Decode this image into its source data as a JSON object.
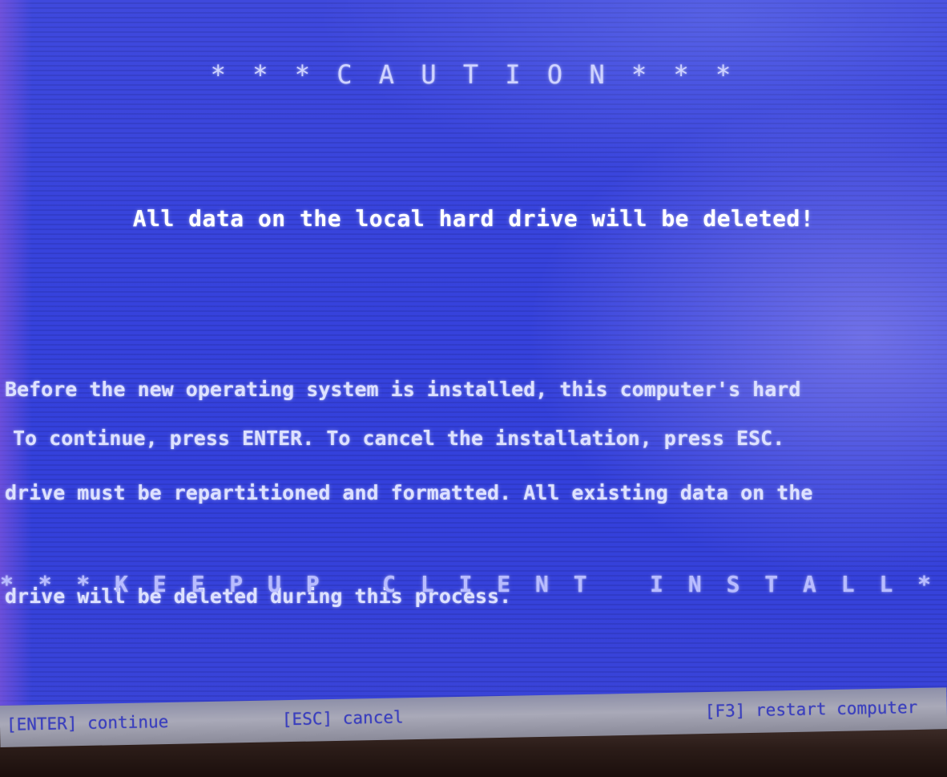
{
  "screen": {
    "background_color": "#3743dc",
    "caution_title": "* * * C A U T I O N * * *",
    "warning": "All data on the local hard drive will be deleted!",
    "paragraph_lines": [
      "Before the new operating system is installed, this computer's hard",
      "drive must be repartitioned and formatted. All existing data on the",
      "drive will be deleted during this process."
    ],
    "instruction": "To continue, press ENTER. To cancel the installation, press ESC.",
    "footer_title": "* * * K E E P U P   C L I E N T   I N S T A L L * * *"
  },
  "statusbar": {
    "background_color": "#a9a9b8",
    "text_color": "#3a3fbf",
    "items": [
      {
        "key": "[ENTER]",
        "label": "continue"
      },
      {
        "key": "[ESC]",
        "label": "cancel"
      },
      {
        "key": "[F3]",
        "label": "restart computer"
      }
    ]
  }
}
